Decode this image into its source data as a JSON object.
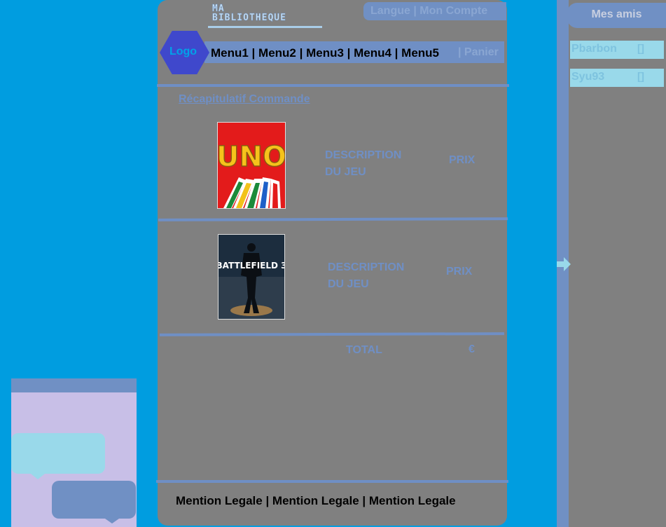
{
  "header": {
    "site_title_line1": "MA",
    "site_title_line2": "BIBLIOTHEQUE",
    "top_links": "Langue | Mon Compte",
    "logo_label": "Logo",
    "menu": "Menu1 | Menu2 | Menu3 | Menu4 | Menu5",
    "cart_label": "| Panier"
  },
  "order": {
    "title": "Récapitulatif Commande",
    "items": [
      {
        "cover": "uno-game-cover",
        "description_line1": "DESCRIPTION",
        "description_line2": "DU JEU",
        "price": "PRIX"
      },
      {
        "cover": "battlefield-3-game-cover",
        "description_line1": "DESCRIPTION",
        "description_line2": "DU JEU",
        "price": "PRIX"
      }
    ],
    "total_label": "TOTAL",
    "currency": "€"
  },
  "footer": {
    "text": "Mention Legale | Mention Legale | Mention Legale"
  },
  "friends": {
    "title": "Mes amis",
    "list": [
      {
        "name": "Pbarbon",
        "status": "[]"
      },
      {
        "name": "Syu93",
        "status": "[]"
      }
    ]
  },
  "cover_art": {
    "uno": "UNO",
    "battlefield": "BATTLEFIELD 3"
  },
  "colors": {
    "page_background": "#009de0",
    "panel_gray": "#808080",
    "accent_blue": "#6f8fc5",
    "light_cyan": "#99d9ea",
    "chat_lavender": "#c8bfe7",
    "logo_blue": "#3f48cc"
  }
}
